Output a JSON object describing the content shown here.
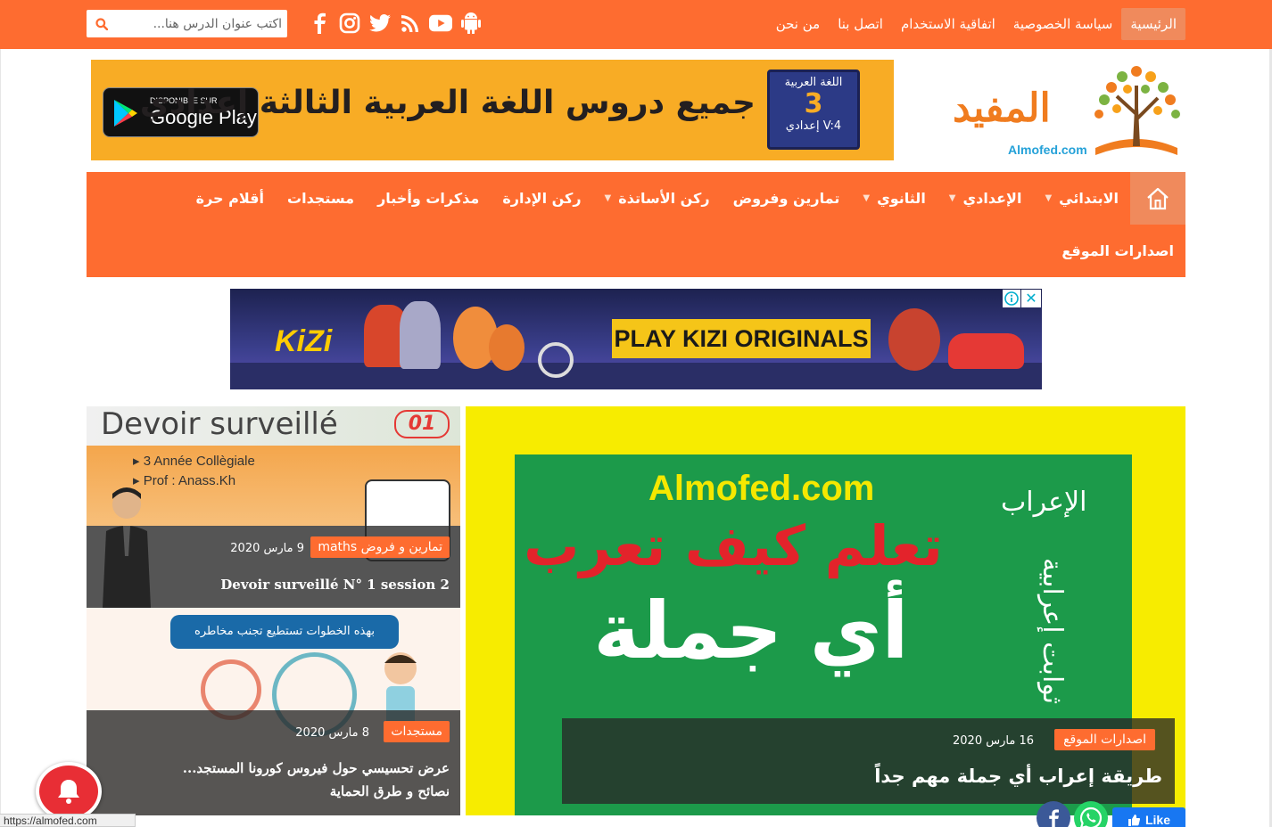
{
  "top_nav": {
    "items": [
      {
        "label": "الرئيسية",
        "active": true
      },
      {
        "label": "سياسة الخصوصية"
      },
      {
        "label": "اتفاقية الاستخدام"
      },
      {
        "label": "اتصل بنا"
      },
      {
        "label": "من نحن"
      }
    ]
  },
  "social_icons": [
    "android-icon",
    "youtube-icon",
    "rss-icon",
    "twitter-icon",
    "instagram-icon",
    "facebook-icon"
  ],
  "search": {
    "placeholder": "اكتب عنوان الدرس هنا..."
  },
  "logo": {
    "word": "المفيد",
    "domain": "Almofed.com"
  },
  "banner": {
    "headline": "جميع دروس اللغة العربية الثالثة إعدادي",
    "store_small": "DISPONIBLE SUR",
    "store_big": "Google Play",
    "book_line1": "اللغة العربية",
    "book_line2": "3",
    "book_line3": "إعدادي V:4"
  },
  "main_nav": {
    "items": [
      {
        "label": "الابتدائي",
        "dropdown": true
      },
      {
        "label": "الإعدادي",
        "dropdown": true
      },
      {
        "label": "الثانوي",
        "dropdown": true
      },
      {
        "label": "تمارين وفروض",
        "dropdown": false
      },
      {
        "label": "ركن الأساتذة",
        "dropdown": true
      },
      {
        "label": "ركن الإدارة",
        "dropdown": false
      },
      {
        "label": "مذكرات وأخبار",
        "dropdown": false
      },
      {
        "label": "مستجدات",
        "dropdown": false
      },
      {
        "label": "أقلام حرة",
        "dropdown": false
      }
    ],
    "second_row": "اصدارات الموقع"
  },
  "ad": {
    "brand": "KiZi",
    "text": "PLAY KIZI ORIGINALS"
  },
  "featured": {
    "image_domain": "Almofed.com",
    "image_line1": "تعلم كيف تعرب",
    "image_line2": "أي جملة",
    "image_side1": "الإعراب",
    "image_side2": "ثوابت إعرابية",
    "category": "اصدارات الموقع",
    "date": "16 مارس 2020",
    "title": "طريقة إعراب أي جملة مهم جداً"
  },
  "posts": [
    {
      "image_title": "Devoir surveillé",
      "image_num": "01",
      "image_line1": "3 Année Collègiale",
      "image_line2": "Prof : Anass.Kh",
      "category": "تمارين و فروض maths",
      "date": "9 مارس 2020",
      "title": "Devoir surveillé N° 1 session 2"
    },
    {
      "image_header": "بهذه الخطوات تستطيع تجنب مخاطره",
      "category": "مستجدات",
      "date": "8 مارس 2020",
      "title_line1": "عرض تحسيسي حول فيروس كورونا المستجد...",
      "title_line2": "نصائح و طرق الحماية"
    }
  ],
  "status_url": "https://almofed.com",
  "like_label": "Like",
  "colors": {
    "accent": "#fe6c30",
    "accent_light": "#f08a5c",
    "banner": "#f8ac25",
    "featured_bg": "#f7ec00",
    "featured_green": "#1c9a4a"
  }
}
